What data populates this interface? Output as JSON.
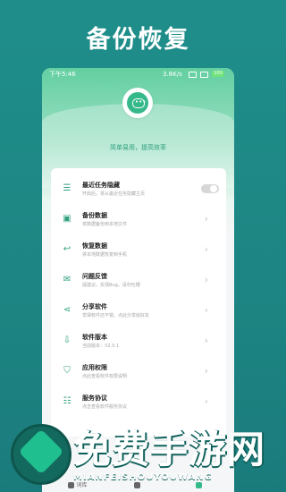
{
  "promo": {
    "title": "备份恢复"
  },
  "status": {
    "time": "下午5:46",
    "speed": "3.8K/s",
    "battery": "100"
  },
  "header": {
    "slogan": "简单易用，提高效率"
  },
  "menu": [
    {
      "title": "最近任务隐藏",
      "desc": "开启后，将从最近任务隐藏主页",
      "icon": "menu-lines-icon",
      "control": "toggle"
    },
    {
      "title": "备份数据",
      "desc": "将数据备份到本地文件",
      "icon": "save-icon",
      "control": "arrow"
    },
    {
      "title": "恢复数据",
      "desc": "将本地数据恢复到手机",
      "icon": "reply-icon",
      "control": "arrow"
    },
    {
      "title": "问题反馈",
      "desc": "提建议，反馈Bug，请勿吐槽",
      "icon": "chat-icon",
      "control": "arrow"
    },
    {
      "title": "分享软件",
      "desc": "觉得软件还不错，点此分享给好友",
      "icon": "share-icon",
      "control": "arrow"
    },
    {
      "title": "软件版本",
      "desc": "当前版本：V2.0.1",
      "icon": "download-icon",
      "control": "arrow"
    },
    {
      "title": "应用权限",
      "desc": "点此查看软件权限说明",
      "icon": "shield-icon",
      "control": "arrow"
    },
    {
      "title": "服务协议",
      "desc": "点击查看软件服务协议",
      "icon": "document-icon",
      "control": "arrow"
    }
  ],
  "tabs": [
    {
      "label": "词库"
    },
    {
      "label": ""
    },
    {
      "label": ""
    }
  ],
  "watermark": {
    "title": "免费手游网",
    "subtitle": "MIANFEISHOUYOUWANG"
  }
}
